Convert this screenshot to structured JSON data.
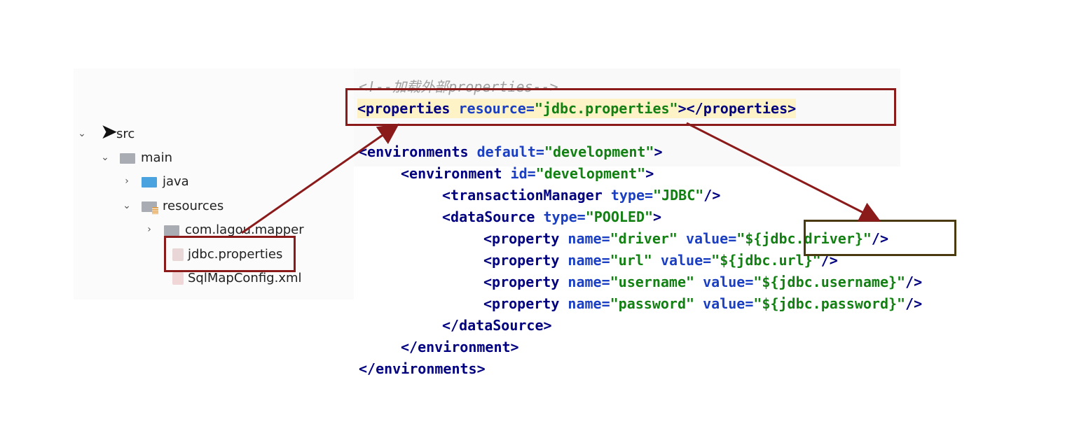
{
  "tree": {
    "items": [
      {
        "label": "src",
        "chevron": "⌄",
        "icon": "folder-icon"
      },
      {
        "label": "main",
        "chevron": "⌄",
        "icon": "folder-icon"
      },
      {
        "label": "java",
        "chevron": "›",
        "icon": "folder-icon"
      },
      {
        "label": "resources",
        "chevron": "⌄",
        "icon": "resources-folder-icon"
      },
      {
        "label": "com.lagou.mapper",
        "chevron": "›",
        "icon": "package-icon"
      },
      {
        "label": "jdbc.properties",
        "icon": "properties-file-icon"
      },
      {
        "label": "SqlMapConfig.xml",
        "icon": "xml-file-icon"
      }
    ]
  },
  "code": {
    "comment": "<!--加载外部properties-->",
    "properties_open": "<properties",
    "properties_attr": "resource=",
    "properties_val": "\"jdbc.properties\"",
    "properties_close": "></properties>",
    "environments_open": "<environments",
    "environments_attr": "default=",
    "environments_val": "\"development\"",
    "environments_end": ">",
    "environment_open": "<environment",
    "environment_attr": "id=",
    "environment_val": "\"development\"",
    "environment_end": ">",
    "tm_open": "<transactionManager",
    "tm_attr": "type=",
    "tm_val": "\"JDBC\"",
    "tm_end": "/>",
    "ds_open": "<dataSource",
    "ds_attr": "type=",
    "ds_val": "\"POOLED\"",
    "ds_end": ">",
    "prop_open": "<property",
    "name_attr": "name=",
    "value_attr": "value=",
    "prop_end": "/>",
    "props": [
      {
        "name": "\"driver\"",
        "value": "\"${jdbc.driver}\""
      },
      {
        "name": "\"url\"",
        "value": "\"${jdbc.url}\""
      },
      {
        "name": "\"username\"",
        "value": "\"${jdbc.username}\""
      },
      {
        "name": "\"password\"",
        "value": "\"${jdbc.password}\""
      }
    ],
    "ds_close": "</dataSource>",
    "environment_close": "</environment>",
    "environments_close": "</environments>"
  },
  "colors": {
    "annotation": "#8b1a1a",
    "tag": "#000080",
    "attr": "#1a3fc2",
    "string": "#128012"
  }
}
